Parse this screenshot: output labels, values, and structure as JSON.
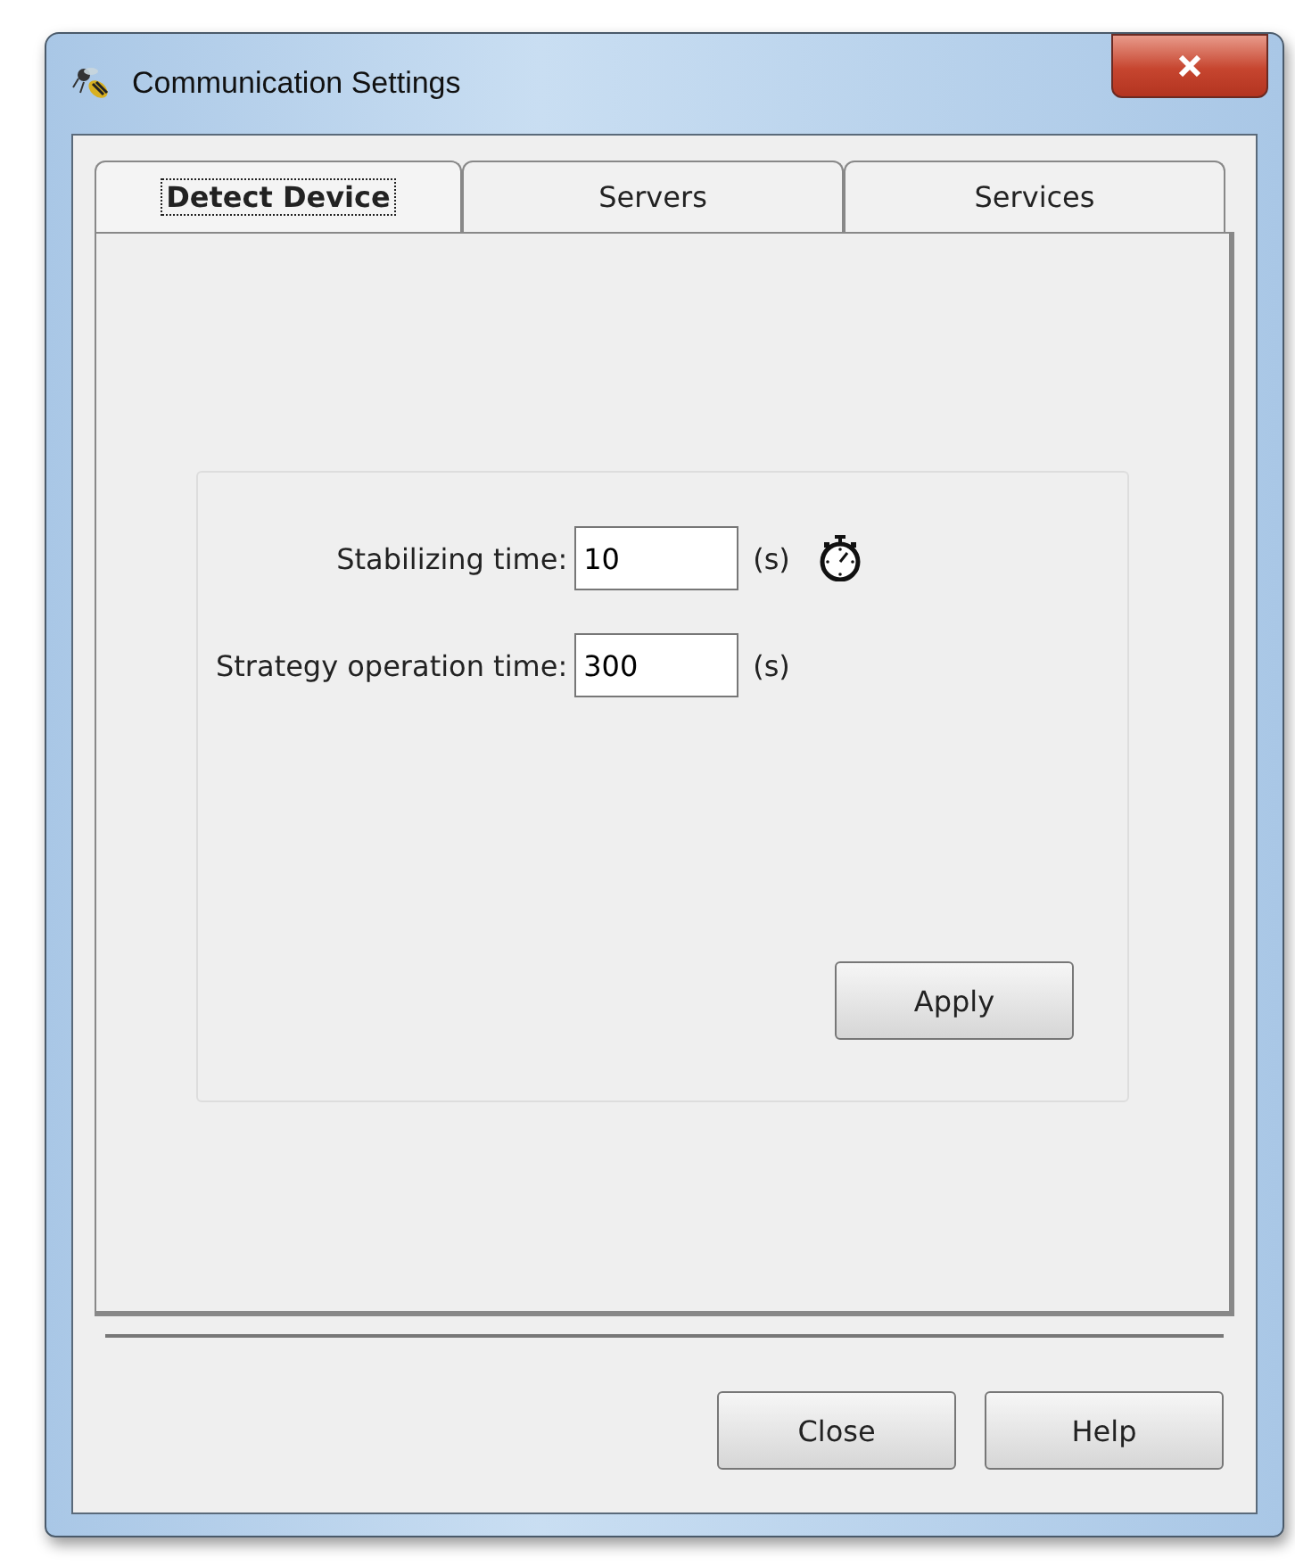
{
  "window": {
    "title": "Communication Settings"
  },
  "tabs": [
    {
      "label": "Detect Device",
      "selected": true
    },
    {
      "label": "Servers",
      "selected": false
    },
    {
      "label": "Services",
      "selected": false
    }
  ],
  "fields": [
    {
      "label": "Stabilizing time:",
      "value": "10",
      "unit": "(s)",
      "timer_icon": true
    },
    {
      "label": "Strategy operation time:",
      "value": "300",
      "unit": "(s)",
      "timer_icon": false
    }
  ],
  "apply_button": "Apply",
  "buttons": [
    "Close",
    "Help"
  ]
}
